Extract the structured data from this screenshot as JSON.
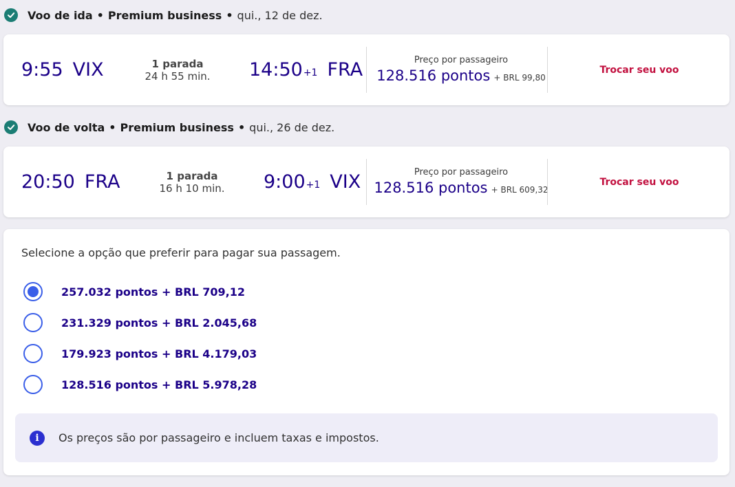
{
  "outbound": {
    "title": "Voo de ida",
    "cabin": "Premium business",
    "date": "qui., 12 de dez.",
    "departure_time": "9:55",
    "departure_code": "VIX",
    "stops": "1 parada",
    "duration": "24 h 55 min.",
    "arrival_time": "14:50",
    "arrival_day_offset": "+1",
    "arrival_code": "FRA",
    "price_label": "Preço por passageiro",
    "price_points": "128.516 pontos",
    "price_extra": "+ BRL 99,80",
    "change_label": "Trocar seu voo"
  },
  "return": {
    "title": "Voo de volta",
    "cabin": "Premium business",
    "date": "qui., 26 de dez.",
    "departure_time": "20:50",
    "departure_code": "FRA",
    "stops": "1 parada",
    "duration": "16 h 10 min.",
    "arrival_time": "9:00",
    "arrival_day_offset": "+1",
    "arrival_code": "VIX",
    "price_label": "Preço por passageiro",
    "price_points": "128.516 pontos",
    "price_extra": "+ BRL 609,32",
    "change_label": "Trocar seu voo"
  },
  "payment": {
    "title": "Selecione a opção que preferir para pagar sua passagem.",
    "selected_index": 0,
    "options": [
      {
        "label": "257.032 pontos + BRL 709,12"
      },
      {
        "label": "231.329 pontos + BRL 2.045,68"
      },
      {
        "label": "179.923 pontos + BRL 4.179,03"
      },
      {
        "label": "128.516 pontos + BRL 5.978,28"
      }
    ],
    "info_text": "Os preços são por passageiro e incluem taxas e impostos."
  },
  "colors": {
    "primary": "#1b0088",
    "accent_red": "#c2103f",
    "check_green": "#1b7d74",
    "radio_blue": "#3a5ee8"
  },
  "icons": {
    "segment_status": "check-circle-icon",
    "info": "info-icon"
  }
}
